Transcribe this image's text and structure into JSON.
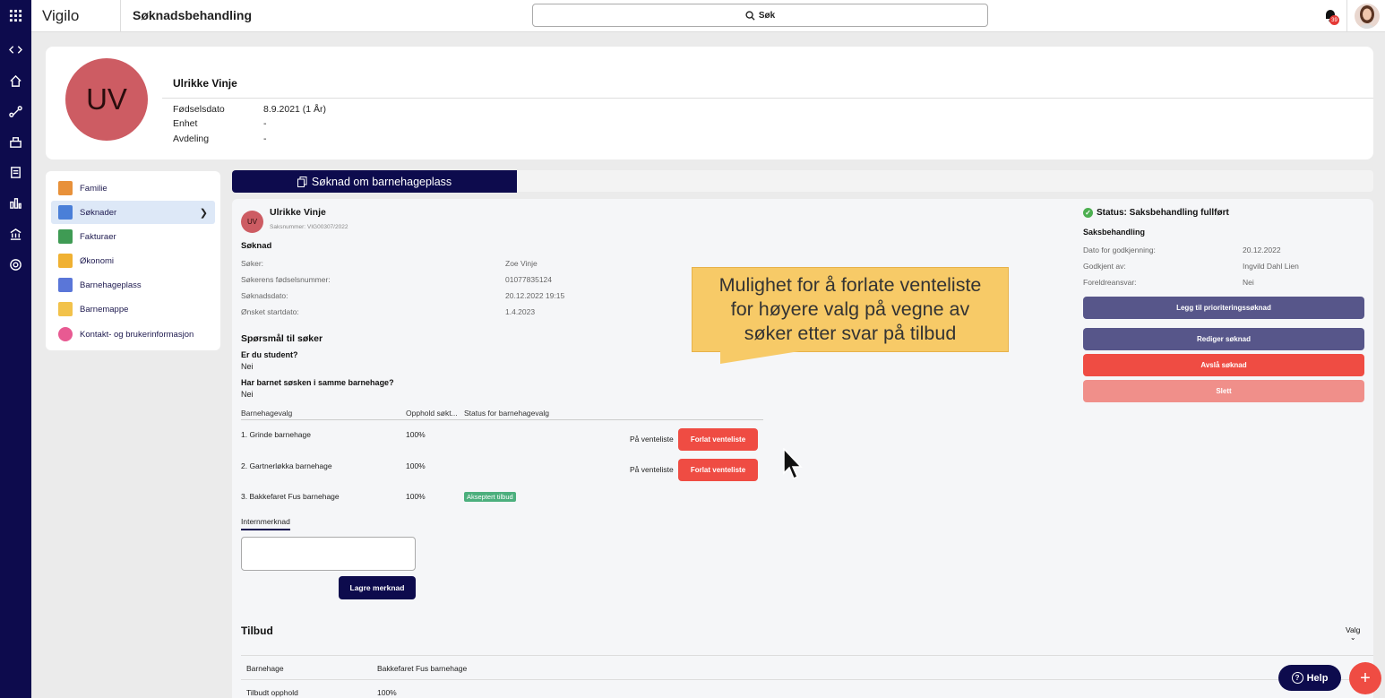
{
  "header": {
    "brand": "Vigilo",
    "app_title": "Søknadsbehandling",
    "search_label": "Søk",
    "notification_count": "39"
  },
  "rail": {
    "icons": [
      "grid-icon",
      "code-icon",
      "home-icon",
      "route-icon",
      "building-icon",
      "document-icon",
      "chart-icon",
      "bank-icon",
      "gear-icon"
    ]
  },
  "profile": {
    "initials": "UV",
    "name": "Ulrikke Vinje",
    "fields": [
      {
        "label": "Fødselsdato",
        "value": "8.9.2021 (1 År)"
      },
      {
        "label": "Enhet",
        "value": "-"
      },
      {
        "label": "Avdeling",
        "value": "-"
      }
    ]
  },
  "menu": {
    "items": [
      {
        "label": "Familie",
        "color": "#e8913a"
      },
      {
        "label": "Søknader",
        "color": "#4a7fd8"
      },
      {
        "label": "Fakturaer",
        "color": "#3f9b54"
      },
      {
        "label": "Økonomi",
        "color": "#f0b132"
      },
      {
        "label": "Barnehageplass",
        "color": "#5a76d8"
      },
      {
        "label": "Barnemappe",
        "color": "#f2c24b"
      },
      {
        "label": "Kontakt- og brukerinformasjon",
        "color": "#e85a92"
      }
    ]
  },
  "tab": {
    "label": "Søknad om barnehageplass"
  },
  "soknad": {
    "initials": "UV",
    "name": "Ulrikke Vinje",
    "saksnummer": "Saksnummer: VIG00307/2022",
    "section_title": "Søknad",
    "fields": [
      {
        "label": "Søker:",
        "value": "Zoe Vinje"
      },
      {
        "label": "Søkerens fødselsnummer:",
        "value": "01077835124"
      },
      {
        "label": "Søknadsdato:",
        "value": "20.12.2022 19:15"
      },
      {
        "label": "Ønsket startdato:",
        "value": "1.4.2023"
      }
    ],
    "questions_title": "Spørsmål til søker",
    "questions": [
      {
        "q": "Er du student?",
        "a": "Nei"
      },
      {
        "q": "Har barnet søsken i samme barnehage?",
        "a": "Nei"
      }
    ],
    "table_headers": [
      "Barnehagevalg",
      "Opphold søkt...",
      "Status for barnehagevalg"
    ],
    "rows": [
      {
        "name": "1. Grinde barnehage",
        "pct": "100%",
        "status": "På venteliste",
        "action": "Forlat venteliste"
      },
      {
        "name": "2. Gartnerløkka barnehage",
        "pct": "100%",
        "status": "På venteliste",
        "action": "Forlat venteliste"
      },
      {
        "name": "3. Bakkefaret Fus barnehage",
        "pct": "100%",
        "badge": "Akseptert tilbud"
      }
    ],
    "intern_tab": "Internmerknad",
    "save_note": "Lagre merknad",
    "tilbud_title": "Tilbud",
    "valg_label": "Valg",
    "tilbud_rows": [
      {
        "label": "Barnehage",
        "value": "Bakkefaret Fus barnehage"
      },
      {
        "label": "Tilbudt opphold",
        "value": "100%"
      }
    ]
  },
  "status": {
    "title": "Status: Saksbehandling fullført",
    "section": "Saksbehandling",
    "fields": [
      {
        "label": "Dato for godkjenning:",
        "value": "20.12.2022"
      },
      {
        "label": "Godkjent av:",
        "value": "Ingvild Dahl Lien"
      },
      {
        "label": "Foreldreansvar:",
        "value": "Nei"
      }
    ],
    "buttons": [
      {
        "label": "Legg til prioriteringssøknad",
        "color": "#57568a"
      },
      {
        "label": "Rediger søknad",
        "color": "#57568a"
      },
      {
        "label": "Avslå søknad",
        "color": "#ef4c43"
      },
      {
        "label": "Slett",
        "color": "#f08f8a"
      }
    ]
  },
  "callout": {
    "lines": [
      "Mulighet for å forlate venteliste",
      "for høyere valg på vegne av",
      "søker etter svar på tilbud"
    ]
  },
  "fab": {
    "help_label": "Help",
    "plus_label": "+"
  }
}
